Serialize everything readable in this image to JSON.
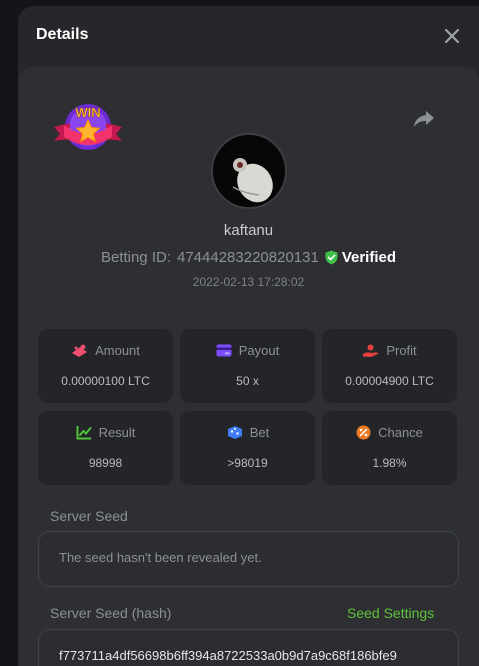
{
  "modal": {
    "title": "Details"
  },
  "icons": {
    "close": "close-icon",
    "share": "share-icon",
    "badge": "win-badge-icon",
    "verified": "shield-check-icon",
    "amount": "amount-icon",
    "payout": "payout-card-icon",
    "profit": "profit-icon",
    "result": "result-chart-icon",
    "bet": "bet-dice-icon",
    "chance": "chance-percent-icon"
  },
  "badge": {
    "text": "WIN"
  },
  "player": {
    "username": "kaftanu",
    "betting_id_label": "Betting ID:",
    "betting_id": "47444283220820131",
    "verified_label": "Verified",
    "timestamp": "2022-02-13 17:28:02"
  },
  "stats": [
    {
      "label": "Amount",
      "value": "0.00000100 LTC",
      "color": "#f0506e"
    },
    {
      "label": "Payout",
      "value": "50 x",
      "color": "#7b4dff"
    },
    {
      "label": "Profit",
      "value": "0.00004900 LTC",
      "color": "#e8403f"
    },
    {
      "label": "Result",
      "value": "98998",
      "color": "#52c23b"
    },
    {
      "label": "Bet",
      "value": ">98019",
      "color": "#3f7cf5"
    },
    {
      "label": "Chance",
      "value": "1.98%",
      "color": "#f07a22"
    }
  ],
  "server_seed": {
    "label": "Server Seed",
    "value": "The seed hasn't been revealed yet."
  },
  "server_seed_hash": {
    "label": "Server Seed (hash)",
    "settings_link": "Seed Settings",
    "value": "f773711a4df56698b6ff394a8722533a0b9d7a9c68f186bfe9"
  },
  "colors": {
    "accent_green": "#5fc23a",
    "verified_green": "#3fbf4a",
    "modal_bg": "#25272b",
    "card_bg": "#2d2f33"
  }
}
